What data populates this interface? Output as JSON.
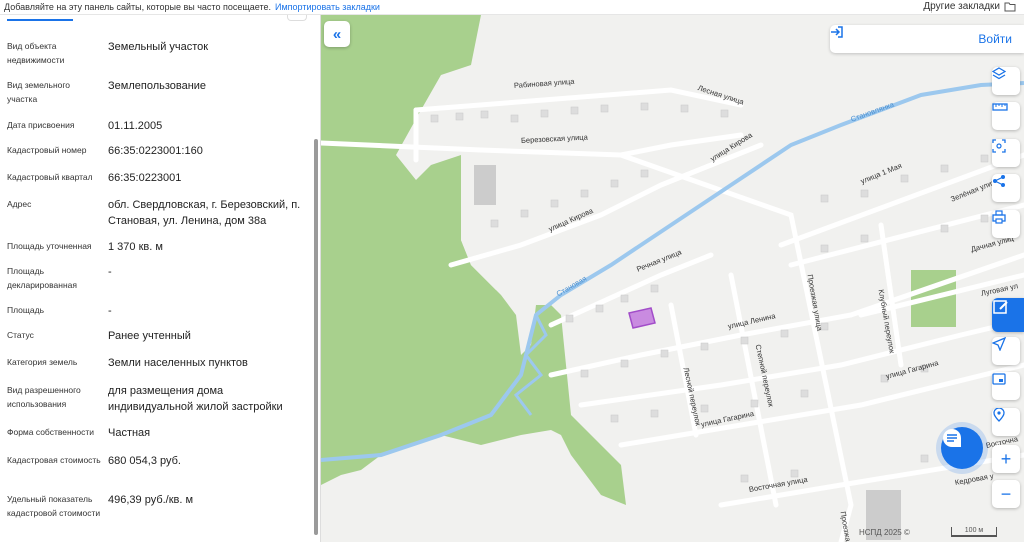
{
  "bookmarks_bar": {
    "text": "Добавляйте на эту панель сайты, которые вы часто посещаете.",
    "import_link": "Импортировать закладки",
    "other": "Другие закладки"
  },
  "details": [
    {
      "label": "Вид объекта недвижимости",
      "value": "Земельный участок"
    },
    {
      "label": "Вид земельного участка",
      "value": "Землепользование"
    },
    {
      "label": "Дата присвоения",
      "value": "01.11.2005"
    },
    {
      "label": "Кадастровый номер",
      "value": "66:35:0223001:160"
    },
    {
      "label": "Кадастровый квартал",
      "value": "66:35:0223001"
    },
    {
      "label": "Адрес",
      "value": "обл. Свердловская, г. Березовский, п. Становая, ул. Ленина, дом 38а"
    },
    {
      "label": "Площадь уточненная",
      "value": "1 370 кв. м"
    },
    {
      "label": "Площадь декларированная",
      "value": "-"
    },
    {
      "label": "Площадь",
      "value": "-"
    },
    {
      "label": "Статус",
      "value": "Ранее учтенный"
    },
    {
      "label": "Категория земель",
      "value": "Земли населенных пунктов"
    },
    {
      "label": "Вид разрешенного использования",
      "value": "для размещения дома индивидуальной жилой застройки"
    },
    {
      "label": "Форма собственности",
      "value": "Частная"
    },
    {
      "label": "Кадастровая стоимость",
      "value": "680 054,3 руб."
    },
    {
      "label": "Удельный показатель кадастровой стоимости",
      "value": "496,39 руб./кв. м"
    }
  ],
  "map": {
    "login_label": "Войти",
    "streets": {
      "ryabinovaya": "Рабиновая улица",
      "lesnaya": "Лесная улица",
      "berezovskaya": "Березовская улица",
      "kirova1": "улица Кирова",
      "kirova2": "улица Кирова",
      "rechnaya": "Речная улица",
      "stanovaya1": "Становая",
      "stanovaya2": "Становлянка",
      "lenina": "улица Ленина",
      "gagarina1": "улица Гагарина",
      "gagarina2": "улица Гагарина",
      "vostochnaya1": "Восточная улица",
      "vostochnaya2": "Восточна",
      "lesnoy_per": "Лесной переулок",
      "stepnoy_per": "Степной переулок",
      "proezzhaya1": "Проезжая улица",
      "proezzhaya2": "Проезжа",
      "klubny_per": "Клубный переулок",
      "may1": "улица 1 Мая",
      "zelenaya": "Зелёная улица",
      "dachnaya": "Дачная улиц",
      "lugovaya": "Луговая ул",
      "kedrovaya": "Кедровая у"
    },
    "copyright": "НСПД 2025 ©",
    "scale": "100 м"
  },
  "colors": {
    "accent": "#1a73e8",
    "forest": "#a8d08d",
    "river": "#9cc8ee",
    "parcel": "#a24dc9"
  }
}
